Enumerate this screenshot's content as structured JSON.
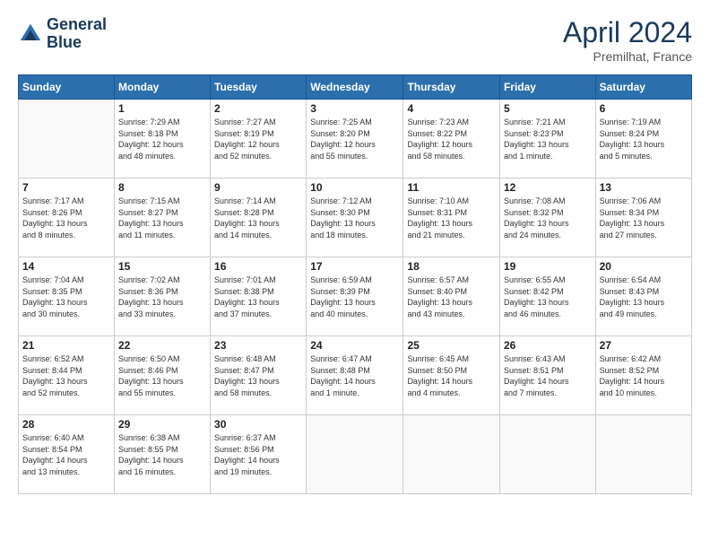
{
  "header": {
    "logo_line1": "General",
    "logo_line2": "Blue",
    "month": "April 2024",
    "location": "Premilhat, France"
  },
  "days_of_week": [
    "Sunday",
    "Monday",
    "Tuesday",
    "Wednesday",
    "Thursday",
    "Friday",
    "Saturday"
  ],
  "weeks": [
    [
      {
        "day": "",
        "info": ""
      },
      {
        "day": "1",
        "info": "Sunrise: 7:29 AM\nSunset: 8:18 PM\nDaylight: 12 hours\nand 48 minutes."
      },
      {
        "day": "2",
        "info": "Sunrise: 7:27 AM\nSunset: 8:19 PM\nDaylight: 12 hours\nand 52 minutes."
      },
      {
        "day": "3",
        "info": "Sunrise: 7:25 AM\nSunset: 8:20 PM\nDaylight: 12 hours\nand 55 minutes."
      },
      {
        "day": "4",
        "info": "Sunrise: 7:23 AM\nSunset: 8:22 PM\nDaylight: 12 hours\nand 58 minutes."
      },
      {
        "day": "5",
        "info": "Sunrise: 7:21 AM\nSunset: 8:23 PM\nDaylight: 13 hours\nand 1 minute."
      },
      {
        "day": "6",
        "info": "Sunrise: 7:19 AM\nSunset: 8:24 PM\nDaylight: 13 hours\nand 5 minutes."
      }
    ],
    [
      {
        "day": "7",
        "info": "Sunrise: 7:17 AM\nSunset: 8:26 PM\nDaylight: 13 hours\nand 8 minutes."
      },
      {
        "day": "8",
        "info": "Sunrise: 7:15 AM\nSunset: 8:27 PM\nDaylight: 13 hours\nand 11 minutes."
      },
      {
        "day": "9",
        "info": "Sunrise: 7:14 AM\nSunset: 8:28 PM\nDaylight: 13 hours\nand 14 minutes."
      },
      {
        "day": "10",
        "info": "Sunrise: 7:12 AM\nSunset: 8:30 PM\nDaylight: 13 hours\nand 18 minutes."
      },
      {
        "day": "11",
        "info": "Sunrise: 7:10 AM\nSunset: 8:31 PM\nDaylight: 13 hours\nand 21 minutes."
      },
      {
        "day": "12",
        "info": "Sunrise: 7:08 AM\nSunset: 8:32 PM\nDaylight: 13 hours\nand 24 minutes."
      },
      {
        "day": "13",
        "info": "Sunrise: 7:06 AM\nSunset: 8:34 PM\nDaylight: 13 hours\nand 27 minutes."
      }
    ],
    [
      {
        "day": "14",
        "info": "Sunrise: 7:04 AM\nSunset: 8:35 PM\nDaylight: 13 hours\nand 30 minutes."
      },
      {
        "day": "15",
        "info": "Sunrise: 7:02 AM\nSunset: 8:36 PM\nDaylight: 13 hours\nand 33 minutes."
      },
      {
        "day": "16",
        "info": "Sunrise: 7:01 AM\nSunset: 8:38 PM\nDaylight: 13 hours\nand 37 minutes."
      },
      {
        "day": "17",
        "info": "Sunrise: 6:59 AM\nSunset: 8:39 PM\nDaylight: 13 hours\nand 40 minutes."
      },
      {
        "day": "18",
        "info": "Sunrise: 6:57 AM\nSunset: 8:40 PM\nDaylight: 13 hours\nand 43 minutes."
      },
      {
        "day": "19",
        "info": "Sunrise: 6:55 AM\nSunset: 8:42 PM\nDaylight: 13 hours\nand 46 minutes."
      },
      {
        "day": "20",
        "info": "Sunrise: 6:54 AM\nSunset: 8:43 PM\nDaylight: 13 hours\nand 49 minutes."
      }
    ],
    [
      {
        "day": "21",
        "info": "Sunrise: 6:52 AM\nSunset: 8:44 PM\nDaylight: 13 hours\nand 52 minutes."
      },
      {
        "day": "22",
        "info": "Sunrise: 6:50 AM\nSunset: 8:46 PM\nDaylight: 13 hours\nand 55 minutes."
      },
      {
        "day": "23",
        "info": "Sunrise: 6:48 AM\nSunset: 8:47 PM\nDaylight: 13 hours\nand 58 minutes."
      },
      {
        "day": "24",
        "info": "Sunrise: 6:47 AM\nSunset: 8:48 PM\nDaylight: 14 hours\nand 1 minute."
      },
      {
        "day": "25",
        "info": "Sunrise: 6:45 AM\nSunset: 8:50 PM\nDaylight: 14 hours\nand 4 minutes."
      },
      {
        "day": "26",
        "info": "Sunrise: 6:43 AM\nSunset: 8:51 PM\nDaylight: 14 hours\nand 7 minutes."
      },
      {
        "day": "27",
        "info": "Sunrise: 6:42 AM\nSunset: 8:52 PM\nDaylight: 14 hours\nand 10 minutes."
      }
    ],
    [
      {
        "day": "28",
        "info": "Sunrise: 6:40 AM\nSunset: 8:54 PM\nDaylight: 14 hours\nand 13 minutes."
      },
      {
        "day": "29",
        "info": "Sunrise: 6:38 AM\nSunset: 8:55 PM\nDaylight: 14 hours\nand 16 minutes."
      },
      {
        "day": "30",
        "info": "Sunrise: 6:37 AM\nSunset: 8:56 PM\nDaylight: 14 hours\nand 19 minutes."
      },
      {
        "day": "",
        "info": ""
      },
      {
        "day": "",
        "info": ""
      },
      {
        "day": "",
        "info": ""
      },
      {
        "day": "",
        "info": ""
      }
    ]
  ]
}
